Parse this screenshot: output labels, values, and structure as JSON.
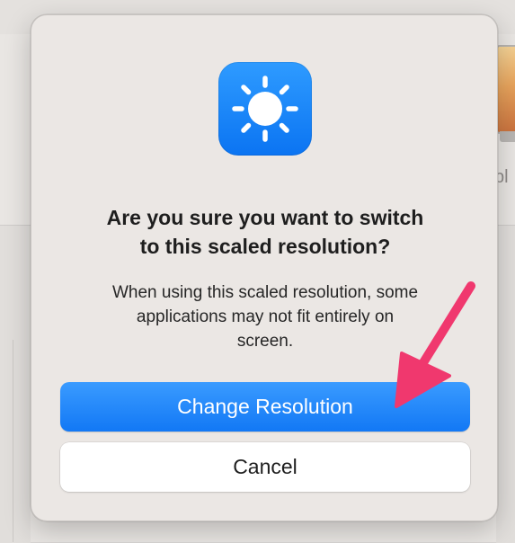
{
  "background": {
    "partial_text": "pl"
  },
  "dialog": {
    "icon": "sun-brightness-icon",
    "title_line1": "Are you sure you want to switch",
    "title_line2": "to this scaled resolution?",
    "message_line1": "When using this scaled resolution, some",
    "message_line2": "applications may not fit entirely on",
    "message_line3": "screen.",
    "primary_button": "Change Resolution",
    "secondary_button": "Cancel"
  },
  "annotation": {
    "arrow": "pink-arrow-pointing-to-change-resolution",
    "color": "#f0386e"
  },
  "colors": {
    "accent": "#1278f5",
    "dialog_bg": "#ebe7e4"
  }
}
